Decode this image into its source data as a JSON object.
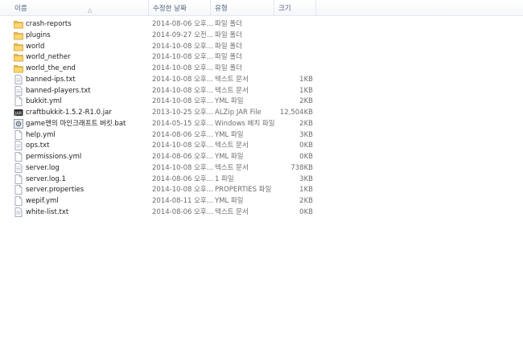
{
  "columns": {
    "name": "이름",
    "date": "수정한 날짜",
    "type": "유형",
    "size": "크기"
  },
  "files": [
    {
      "name": "crash-reports",
      "date": "2014-08-06 오후...",
      "type": "파일 폴더",
      "size": "",
      "icon": "folder-icon"
    },
    {
      "name": "plugins",
      "date": "2014-09-27 오전...",
      "type": "파일 폴더",
      "size": "",
      "icon": "folder-icon"
    },
    {
      "name": "world",
      "date": "2014-10-08 오후...",
      "type": "파일 폴더",
      "size": "",
      "icon": "folder-icon"
    },
    {
      "name": "world_nether",
      "date": "2014-10-08 오후...",
      "type": "파일 폴더",
      "size": "",
      "icon": "folder-icon"
    },
    {
      "name": "world_the_end",
      "date": "2014-10-08 오후...",
      "type": "파일 폴더",
      "size": "",
      "icon": "folder-icon"
    },
    {
      "name": "banned-ips.txt",
      "date": "2014-10-08 오후...",
      "type": "텍스트 문서",
      "size": "1KB",
      "icon": "text-file-icon"
    },
    {
      "name": "banned-players.txt",
      "date": "2014-10-08 오후...",
      "type": "텍스트 문서",
      "size": "1KB",
      "icon": "text-file-icon"
    },
    {
      "name": "bukkit.yml",
      "date": "2014-10-08 오후...",
      "type": "YML 파일",
      "size": "2KB",
      "icon": "file-icon"
    },
    {
      "name": "craftbukkit-1.5.2-R1.0.jar",
      "date": "2013-10-25 오후...",
      "type": "ALZip JAR File",
      "size": "12,504KB",
      "icon": "jar-icon"
    },
    {
      "name": "game맨의 마인크래프트 버킷.bat",
      "date": "2014-05-15 오후...",
      "type": "Windows 배치 파일",
      "size": "2KB",
      "icon": "batch-file-icon"
    },
    {
      "name": "help.yml",
      "date": "2014-08-06 오후...",
      "type": "YML 파일",
      "size": "3KB",
      "icon": "file-icon"
    },
    {
      "name": "ops.txt",
      "date": "2014-10-08 오후...",
      "type": "텍스트 문서",
      "size": "0KB",
      "icon": "text-file-icon"
    },
    {
      "name": "permissions.yml",
      "date": "2014-08-06 오후...",
      "type": "YML 파일",
      "size": "0KB",
      "icon": "file-icon"
    },
    {
      "name": "server.log",
      "date": "2014-10-08 오후...",
      "type": "텍스트 문서",
      "size": "738KB",
      "icon": "text-file-icon"
    },
    {
      "name": "server.log.1",
      "date": "2014-08-06 오후...",
      "type": "1 파일",
      "size": "3KB",
      "icon": "file-icon"
    },
    {
      "name": "server.properties",
      "date": "2014-10-08 오후...",
      "type": "PROPERTIES 파일",
      "size": "1KB",
      "icon": "file-icon"
    },
    {
      "name": "wepif.yml",
      "date": "2014-08-11 오후...",
      "type": "YML 파일",
      "size": "2KB",
      "icon": "file-icon"
    },
    {
      "name": "white-list.txt",
      "date": "2014-08-06 오후...",
      "type": "텍스트 문서",
      "size": "0KB",
      "icon": "text-file-icon"
    }
  ]
}
